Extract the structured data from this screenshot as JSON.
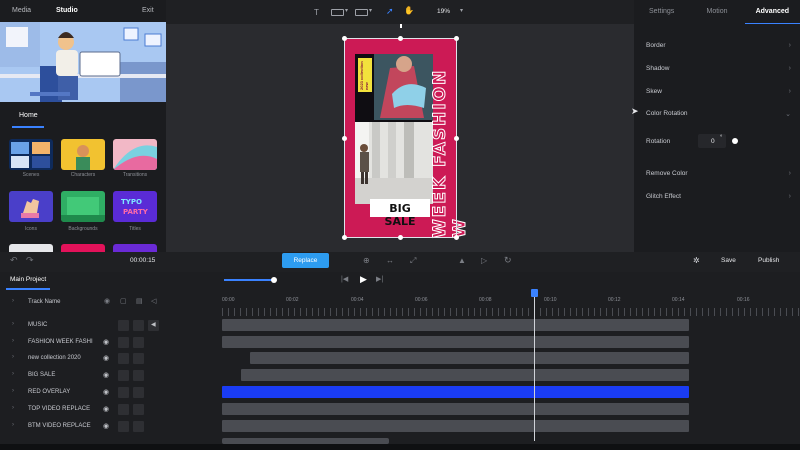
{
  "left_panel": {
    "tabs": [
      "Media",
      "Studio",
      "Exit"
    ],
    "home": "Home",
    "items": [
      {
        "label": "Scenes"
      },
      {
        "label": "Characters"
      },
      {
        "label": "Transitions"
      },
      {
        "label": "Icons"
      },
      {
        "label": "Backgrounds"
      },
      {
        "label": "Titles"
      }
    ]
  },
  "toolbar": {
    "text_icon": "T",
    "zoom": "19%"
  },
  "canvas": {
    "badge_text": "2023 collection new",
    "vertical_text": "WEEK FASHION W",
    "sale_text": "BIG SALE"
  },
  "right_panel": {
    "tabs": [
      "Settings",
      "Motion",
      "Advanced"
    ],
    "rows": [
      {
        "label": "Border"
      },
      {
        "label": "Shadow"
      },
      {
        "label": "Skew"
      },
      {
        "label": "Color Rotation"
      },
      {
        "label": "Rotation",
        "value": "0",
        "unit": "°"
      },
      {
        "label": "Remove Color"
      },
      {
        "label": "Glitch Effect"
      }
    ]
  },
  "transport": {
    "time": "00:00:15",
    "replace": "Replace",
    "save": "Save",
    "publish": "Publish"
  },
  "timeline": {
    "project_tab": "Main Project",
    "track_header": "Track Name",
    "ticks": [
      "00:00",
      "00:02",
      "00:04",
      "00:06",
      "00:08",
      "00:10",
      "00:12",
      "00:14",
      "00:16"
    ],
    "tracks": [
      {
        "name": "MUSIC"
      },
      {
        "name": "FASHION WEEK FASHI"
      },
      {
        "name": "new collection 2020"
      },
      {
        "name": "BIG SALE"
      },
      {
        "name": "RED OVERLAY"
      },
      {
        "name": "TOP VIDEO REPLACE"
      },
      {
        "name": "BTM VIDEO REPLACE"
      }
    ],
    "accent": "#1a3cf5"
  }
}
